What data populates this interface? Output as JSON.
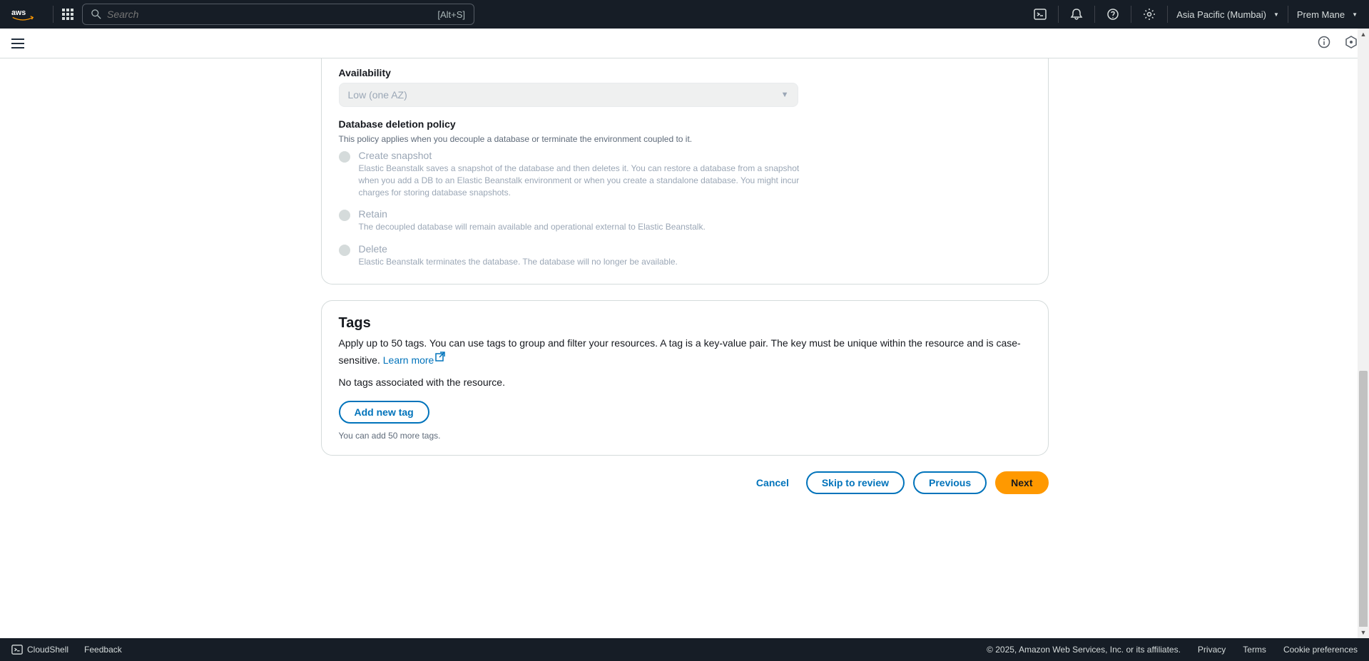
{
  "header": {
    "search_placeholder": "Search",
    "search_shortcut": "[Alt+S]",
    "region": "Asia Pacific (Mumbai)",
    "user": "Prem Mane"
  },
  "availability": {
    "label": "Availability",
    "value": "Low (one AZ)"
  },
  "db_policy": {
    "label": "Database deletion policy",
    "desc": "This policy applies when you decouple a database or terminate the environment coupled to it.",
    "options": [
      {
        "title": "Create snapshot",
        "desc": "Elastic Beanstalk saves a snapshot of the database and then deletes it. You can restore a database from a snapshot when you add a DB to an Elastic Beanstalk environment or when you create a standalone database. You might incur charges for storing database snapshots."
      },
      {
        "title": "Retain",
        "desc": "The decoupled database will remain available and operational external to Elastic Beanstalk."
      },
      {
        "title": "Delete",
        "desc": "Elastic Beanstalk terminates the database. The database will no longer be available."
      }
    ]
  },
  "tags": {
    "title": "Tags",
    "desc_1": "Apply up to 50 tags. You can use tags to group and filter your resources. A tag is a key-value pair. The key must be unique within the resource and is case-sensitive. ",
    "learn_more": "Learn more",
    "no_tags": "No tags associated with the resource.",
    "add_btn": "Add new tag",
    "hint": "You can add 50 more tags."
  },
  "actions": {
    "cancel": "Cancel",
    "skip": "Skip to review",
    "prev": "Previous",
    "next": "Next"
  },
  "footer": {
    "cloudshell": "CloudShell",
    "feedback": "Feedback",
    "copyright": "© 2025, Amazon Web Services, Inc. or its affiliates.",
    "privacy": "Privacy",
    "terms": "Terms",
    "cookies": "Cookie preferences"
  }
}
